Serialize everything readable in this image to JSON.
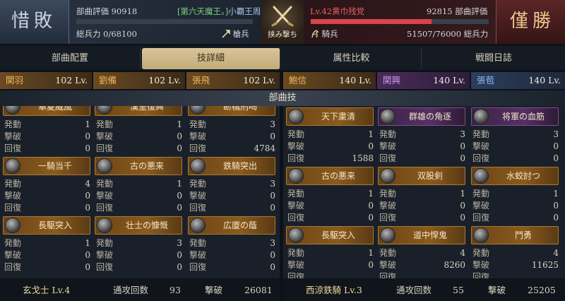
{
  "header": {
    "left": {
      "result": "惜敗",
      "rating_label": "部曲評価",
      "rating_value": "90918",
      "player_tag": "[第六天魔王。]",
      "player_name": "小覇王周通",
      "troops_label": "総兵力",
      "troops_value": "0/68100",
      "troops_fraction": 0.0,
      "unit_type": "槍兵",
      "unit_icon": "spear-icon"
    },
    "right": {
      "result": "僅勝",
      "level_name": "Lv.42黄巾残党",
      "rating_label": "部曲評価",
      "rating_value": "92815",
      "troops_label": "総兵力",
      "troops_value": "51507/76000",
      "troops_fraction": 0.678,
      "unit_type": "騎兵",
      "unit_icon": "horse-icon"
    },
    "center_label": "挟み撃ち",
    "center_icon": "crossed-swords-icon"
  },
  "tabs": [
    {
      "label": "部曲配置",
      "active": false
    },
    {
      "label": "技詳細",
      "active": true
    },
    {
      "label": "属性比較",
      "active": false
    },
    {
      "label": "戦闘日誌",
      "active": false
    }
  ],
  "generals": [
    {
      "name": "関羽",
      "level": "102 Lv.",
      "color": "orange"
    },
    {
      "name": "劉備",
      "level": "102 Lv.",
      "color": "orange"
    },
    {
      "name": "張飛",
      "level": "102 Lv.",
      "color": "orange"
    },
    {
      "name": "鮑信",
      "level": "140 Lv.",
      "color": "orange"
    },
    {
      "name": "関興",
      "level": "140 Lv.",
      "color": "purple"
    },
    {
      "name": "張苞",
      "level": "140 Lv.",
      "color": "blue"
    }
  ],
  "section_title": "部曲技",
  "stat_labels": {
    "activate": "発動",
    "kill": "撃破",
    "heal": "回復"
  },
  "left_skills": [
    {
      "name": "華夏威風",
      "activate": "1",
      "kill": "0",
      "heal": "0",
      "style": "orange"
    },
    {
      "name": "漢室復興",
      "activate": "1",
      "kill": "0",
      "heal": "0",
      "style": "orange"
    },
    {
      "name": "断橋刑喝",
      "activate": "3",
      "kill": "0",
      "heal": "4784",
      "style": "orange"
    },
    {
      "name": "一騎当千",
      "activate": "4",
      "kill": "0",
      "heal": "0",
      "style": "orange"
    },
    {
      "name": "古の悪来",
      "activate": "1",
      "kill": "0",
      "heal": "0",
      "style": "orange"
    },
    {
      "name": "鉄騎突出",
      "activate": "3",
      "kill": "0",
      "heal": "0",
      "style": "orange"
    },
    {
      "name": "長駆突入",
      "activate": "1",
      "kill": "0",
      "heal": "0",
      "style": "orange"
    },
    {
      "name": "壮士の慷慨",
      "activate": "3",
      "kill": "0",
      "heal": "0",
      "style": "orange"
    },
    {
      "name": "広廈の蔭",
      "activate": "3",
      "kill": "0",
      "heal": "0",
      "style": "orange"
    }
  ],
  "right_skills": [
    {
      "name": "天下粛清",
      "activate": "1",
      "kill": "0",
      "heal": "1588",
      "style": "orange"
    },
    {
      "name": "群雄の角逐",
      "activate": "3",
      "kill": "0",
      "heal": "0",
      "style": "purple"
    },
    {
      "name": "将軍の血筋",
      "activate": "3",
      "kill": "0",
      "heal": "0",
      "style": "purple"
    },
    {
      "name": "古の悪来",
      "activate": "1",
      "kill": "0",
      "heal": "0",
      "style": "orange"
    },
    {
      "name": "双股剣",
      "activate": "1",
      "kill": "0",
      "heal": "0",
      "style": "orange"
    },
    {
      "name": "水蛟討つ",
      "activate": "1",
      "kill": "0",
      "heal": "0",
      "style": "orange"
    },
    {
      "name": "長駆突入",
      "activate": "1",
      "kill": "0",
      "heal": "",
      "style": "orange"
    },
    {
      "name": "道中悍鬼",
      "activate": "4",
      "kill": "8260",
      "heal": "",
      "style": "orange"
    },
    {
      "name": "鬥勇",
      "activate": "4",
      "kill": "11625",
      "heal": "",
      "style": "orange"
    }
  ],
  "footer": {
    "left": {
      "unit": "玄戈士 Lv.4",
      "attacks_label": "通攻回数",
      "attacks": "93",
      "kills_label": "撃破",
      "kills": "26081"
    },
    "right": {
      "unit": "西涼鉄騎 Lv.3",
      "attacks_label": "通攻回数",
      "attacks": "55",
      "kills_label": "撃破",
      "kills": "25205"
    }
  },
  "colors": {
    "orange_accent": "#f0b458",
    "purple_accent": "#c99ae8",
    "blue_accent": "#8fb4ea",
    "left_bar": "#6b8fbf",
    "right_bar": "#d8454a",
    "left_tag": "#7fd07f",
    "right_level": "#e8605e"
  }
}
